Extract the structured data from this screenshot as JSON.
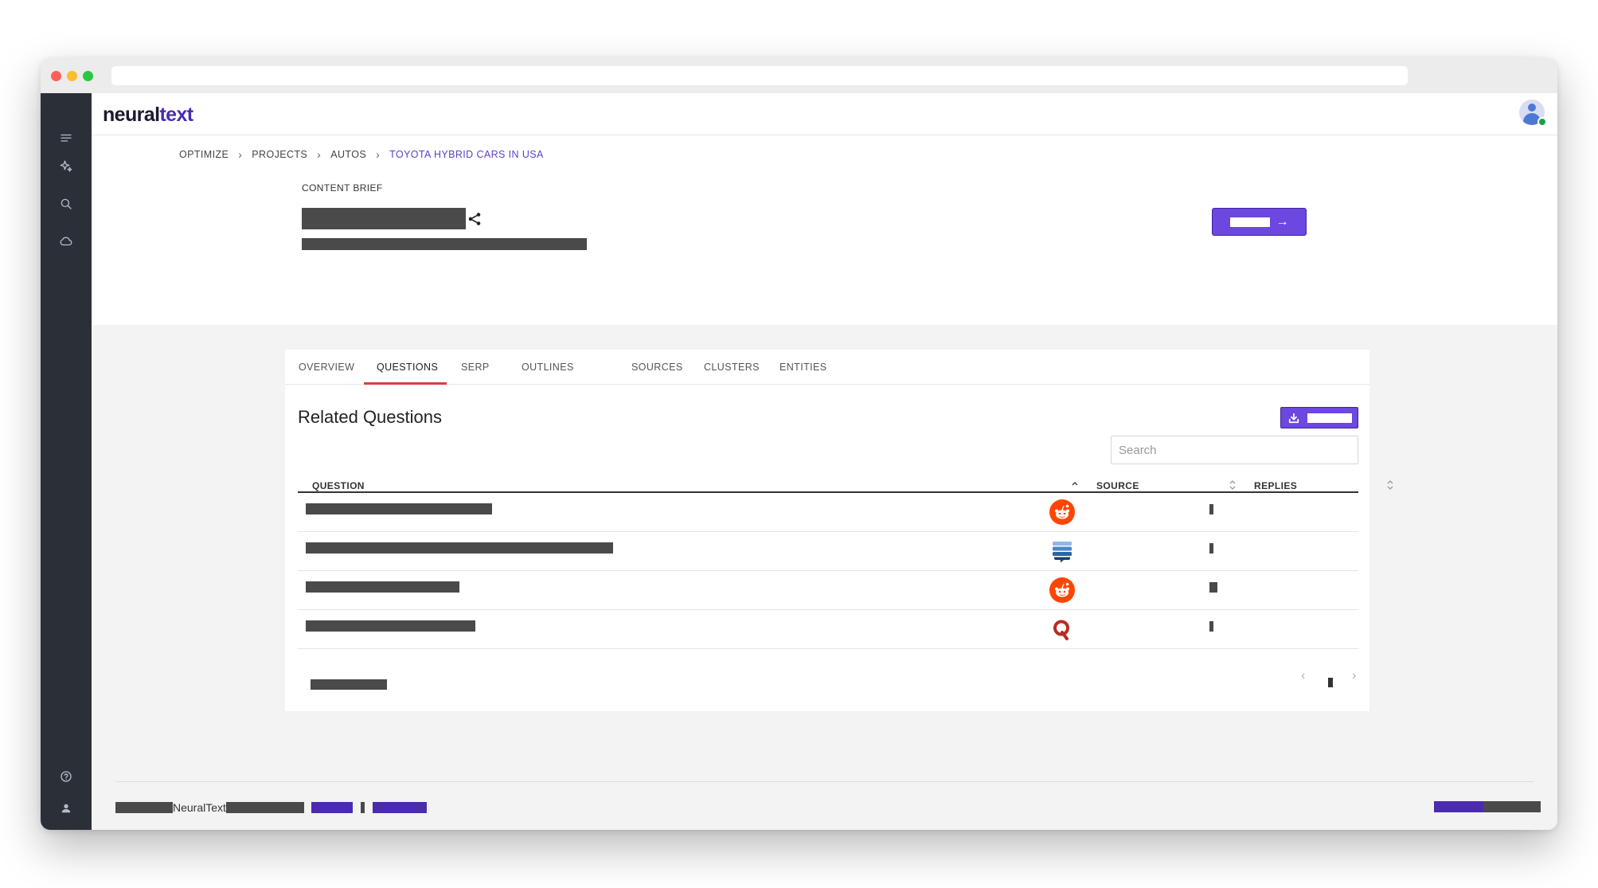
{
  "app": {
    "logo_main": "neural",
    "logo_accent": "text"
  },
  "breadcrumb": [
    {
      "label": "OPTIMIZE"
    },
    {
      "label": "PROJECTS"
    },
    {
      "label": "AUTOS"
    },
    {
      "label": "TOYOTA HYBRID CARS IN USA"
    }
  ],
  "breadcrumb_separator": "›",
  "brief": {
    "label": "CONTENT BRIEF"
  },
  "tabs": [
    {
      "label": "OVERVIEW"
    },
    {
      "label": "QUESTIONS"
    },
    {
      "label": "SERP"
    },
    {
      "label": "OUTLINES"
    },
    {
      "label": "SOURCES"
    },
    {
      "label": "CLUSTERS"
    },
    {
      "label": "ENTITIES"
    }
  ],
  "active_tab": "QUESTIONS",
  "section": {
    "title": "Related Questions",
    "search_placeholder": "Search"
  },
  "table": {
    "columns": [
      {
        "label": "QUESTION",
        "sort": "ascending"
      },
      {
        "label": "SOURCE",
        "sort": "unsorted"
      },
      {
        "label": "REPLIES",
        "sort": "unsorted"
      }
    ],
    "rows": [
      {
        "source_icon": "reddit-icon"
      },
      {
        "source_icon": "stackexchange-icon"
      },
      {
        "source_icon": "reddit-icon"
      },
      {
        "source_icon": "quora-icon"
      }
    ]
  },
  "pagination": {
    "prev": "‹",
    "next": "›"
  },
  "footer": {
    "brand_text": "NeuralText"
  },
  "colors": {
    "accent": "#6c47e0",
    "breadcrumb_active": "#5b3fd1",
    "tab_underline": "#d93f3f",
    "sidebar": "#2b2f38",
    "reddit": "#ff4500",
    "quora": "#b92b27"
  },
  "sidebar_icons": [
    "menu-icon",
    "sparkle-icon",
    "search-icon",
    "cloud-icon",
    "help-icon",
    "user-icon"
  ]
}
